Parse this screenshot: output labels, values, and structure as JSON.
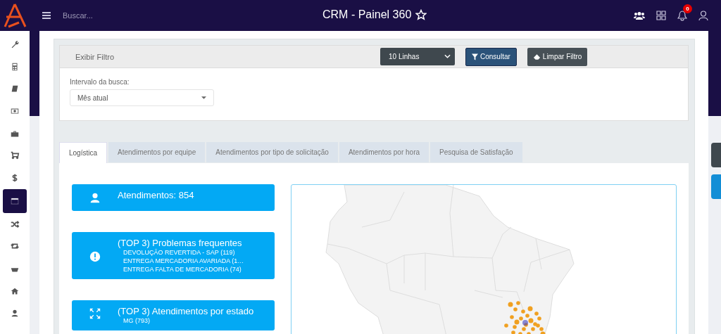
{
  "header": {
    "search_placeholder": "Buscar...",
    "title": "CRM - Painel 360",
    "notification_count": "0"
  },
  "sidebar": {
    "items": [
      {
        "selected": false
      },
      {
        "selected": false
      },
      {
        "selected": false
      },
      {
        "selected": false
      },
      {
        "selected": false
      },
      {
        "selected": false
      },
      {
        "selected": false
      },
      {
        "selected": true
      },
      {
        "selected": false
      },
      {
        "selected": false
      },
      {
        "selected": false
      },
      {
        "selected": false
      },
      {
        "selected": false
      }
    ]
  },
  "filter": {
    "toggle_label": "Exibir Filtro",
    "rows_select": "10 Linhas",
    "query_button": "Consultar",
    "clear_button": "Limpar Filtro",
    "interval_label": "Intervalo da busca:",
    "interval_value": "Mês atual"
  },
  "tabs": [
    {
      "label": "Logística",
      "selected": true
    },
    {
      "label": "Atendimentos por equipe",
      "selected": false
    },
    {
      "label": "Atendimentos por tipo de solicitação",
      "selected": false
    },
    {
      "label": "Atendimentos por hora",
      "selected": false
    },
    {
      "label": "Pesquisa de Satisfação",
      "selected": false
    }
  ],
  "cards": [
    {
      "title": "Atendimentos: 854"
    },
    {
      "title": "(TOP 3) Problemas frequentes",
      "lines": [
        "DEVOLUÇÃO REVERTIDA - SAP (119)",
        "ENTREGA MERCADORIA AVARIADA (1…",
        "ENTREGA FALTA DE MERCADORIA (74)"
      ]
    },
    {
      "title": "(TOP 3) Atendimentos por estado",
      "lines": [
        "MG (793)"
      ]
    }
  ]
}
